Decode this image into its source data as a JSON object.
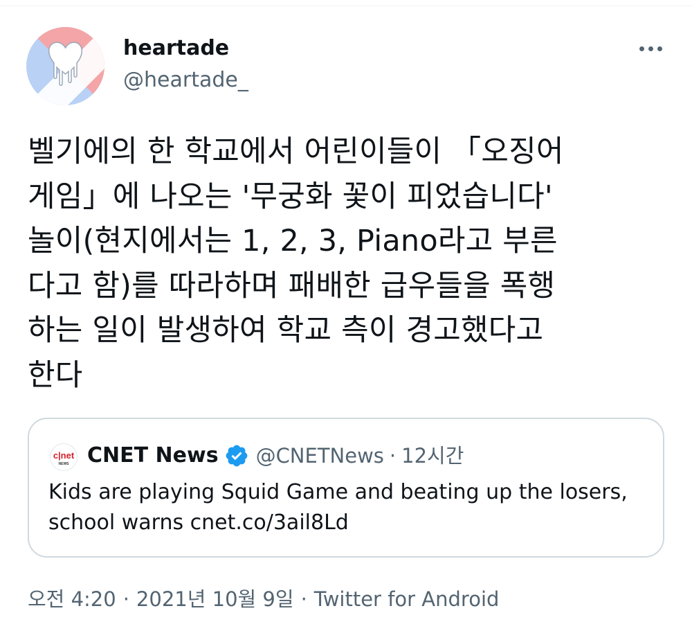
{
  "author": {
    "name": "heartade",
    "handle": "@heartade_",
    "avatar_icon": "dripping-heart-avatar-icon"
  },
  "tweet": {
    "text": "벨기에의 한 학교에서 어린이들이 「오징어\n게임」에 나오는 '무궁화 꽃이 피었습니다'\n놀이(현지에서는 1, 2, 3, Piano라고 부른\n다고 함)를 따라하며 패배한 급우들을 폭행\n하는 일이 발생하여 학교 측이 경고했다고\n한다"
  },
  "quote": {
    "name": "CNET News",
    "handle": "@CNETNews",
    "separator": "·",
    "time": "12시간",
    "avatar_icon": "cnet-news-logo-icon",
    "text": "Kids are playing Squid Game and beating up the losers,\nschool warns cnet.co/3ail8Ld"
  },
  "meta": {
    "time": "오전 4:20",
    "date": "2021년 10월 9일",
    "source": "Twitter for Android",
    "separator": "·"
  },
  "colors": {
    "secondary_text": "#536471",
    "verified_blue": "#1d9bf0",
    "border": "#cfd9de",
    "avatar_pink": "#f4a5a8",
    "avatar_blue": "#b9d1f4",
    "cnet_red": "#d0222d"
  }
}
